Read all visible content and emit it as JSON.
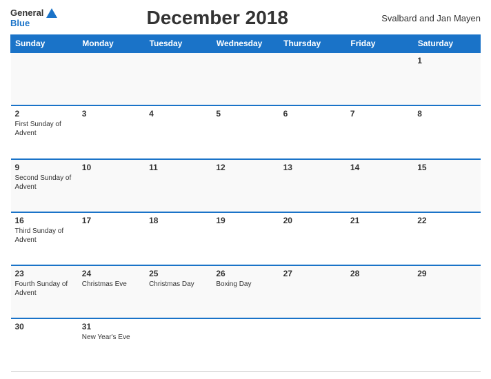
{
  "header": {
    "logo_general": "General",
    "logo_blue": "Blue",
    "title": "December 2018",
    "region": "Svalbard and Jan Mayen"
  },
  "days_of_week": [
    "Sunday",
    "Monday",
    "Tuesday",
    "Wednesday",
    "Thursday",
    "Friday",
    "Saturday"
  ],
  "weeks": [
    {
      "id": "week1",
      "row_class": "row-even",
      "days": [
        {
          "num": "",
          "events": []
        },
        {
          "num": "",
          "events": []
        },
        {
          "num": "",
          "events": []
        },
        {
          "num": "",
          "events": []
        },
        {
          "num": "",
          "events": []
        },
        {
          "num": "",
          "events": []
        },
        {
          "num": "1",
          "events": []
        }
      ]
    },
    {
      "id": "week2",
      "row_class": "row-odd",
      "days": [
        {
          "num": "2",
          "events": [
            "First Sunday of Advent"
          ]
        },
        {
          "num": "3",
          "events": []
        },
        {
          "num": "4",
          "events": []
        },
        {
          "num": "5",
          "events": []
        },
        {
          "num": "6",
          "events": []
        },
        {
          "num": "7",
          "events": []
        },
        {
          "num": "8",
          "events": []
        }
      ]
    },
    {
      "id": "week3",
      "row_class": "row-even",
      "days": [
        {
          "num": "9",
          "events": [
            "Second Sunday of Advent"
          ]
        },
        {
          "num": "10",
          "events": []
        },
        {
          "num": "11",
          "events": []
        },
        {
          "num": "12",
          "events": []
        },
        {
          "num": "13",
          "events": []
        },
        {
          "num": "14",
          "events": []
        },
        {
          "num": "15",
          "events": []
        }
      ]
    },
    {
      "id": "week4",
      "row_class": "row-odd",
      "days": [
        {
          "num": "16",
          "events": [
            "Third Sunday of Advent"
          ]
        },
        {
          "num": "17",
          "events": []
        },
        {
          "num": "18",
          "events": []
        },
        {
          "num": "19",
          "events": []
        },
        {
          "num": "20",
          "events": []
        },
        {
          "num": "21",
          "events": []
        },
        {
          "num": "22",
          "events": []
        }
      ]
    },
    {
      "id": "week5",
      "row_class": "row-even",
      "days": [
        {
          "num": "23",
          "events": [
            "Fourth Sunday of Advent"
          ]
        },
        {
          "num": "24",
          "events": [
            "Christmas Eve"
          ]
        },
        {
          "num": "25",
          "events": [
            "Christmas Day"
          ]
        },
        {
          "num": "26",
          "events": [
            "Boxing Day"
          ]
        },
        {
          "num": "27",
          "events": []
        },
        {
          "num": "28",
          "events": []
        },
        {
          "num": "29",
          "events": []
        }
      ]
    },
    {
      "id": "week6",
      "row_class": "row-odd",
      "days": [
        {
          "num": "30",
          "events": []
        },
        {
          "num": "31",
          "events": [
            "New Year's Eve"
          ]
        },
        {
          "num": "",
          "events": []
        },
        {
          "num": "",
          "events": []
        },
        {
          "num": "",
          "events": []
        },
        {
          "num": "",
          "events": []
        },
        {
          "num": "",
          "events": []
        }
      ]
    }
  ]
}
